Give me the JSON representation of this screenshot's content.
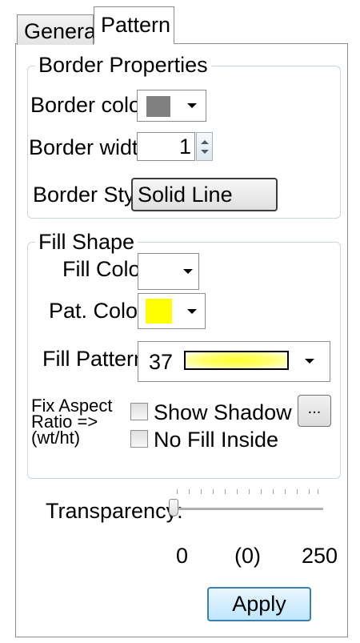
{
  "tabs": [
    {
      "label": "General",
      "selected": false
    },
    {
      "label": "Pattern",
      "selected": true
    }
  ],
  "border_properties": {
    "title": "Border Properties",
    "border_color_label": "Border color:",
    "border_color_value": "#808080",
    "border_width_label": "Border width:",
    "border_width_value": "1",
    "border_style_label": "Border Style:",
    "border_style_value": "Solid Line"
  },
  "fill_shape": {
    "title": "Fill Shape",
    "fill_color_label": "Fill Color:",
    "fill_color_value": "#ffffff",
    "pat_color_label": "Pat. Color:",
    "pat_color_value": "#ffff00",
    "fill_pattern_label": "Fill Pattern:",
    "fill_pattern_number": "37",
    "fix_aspect_line1": "Fix Aspect",
    "fix_aspect_line2": "Ratio =>",
    "fix_aspect_line3": "(wt/ht)",
    "show_shadow_label": "Show Shadow",
    "show_shadow_checked": false,
    "no_fill_inside_label": "No Fill Inside",
    "no_fill_inside_checked": false,
    "ellipsis_button": "..."
  },
  "transparency": {
    "label": "Transparency:",
    "min": "0",
    "current": "(0)",
    "max": "250",
    "value": 0
  },
  "apply_button": "Apply",
  "colors": {
    "dropdown_arrow": "#000000",
    "apply_border": "#3c7fb1",
    "group_border": "#c9d6e3"
  }
}
